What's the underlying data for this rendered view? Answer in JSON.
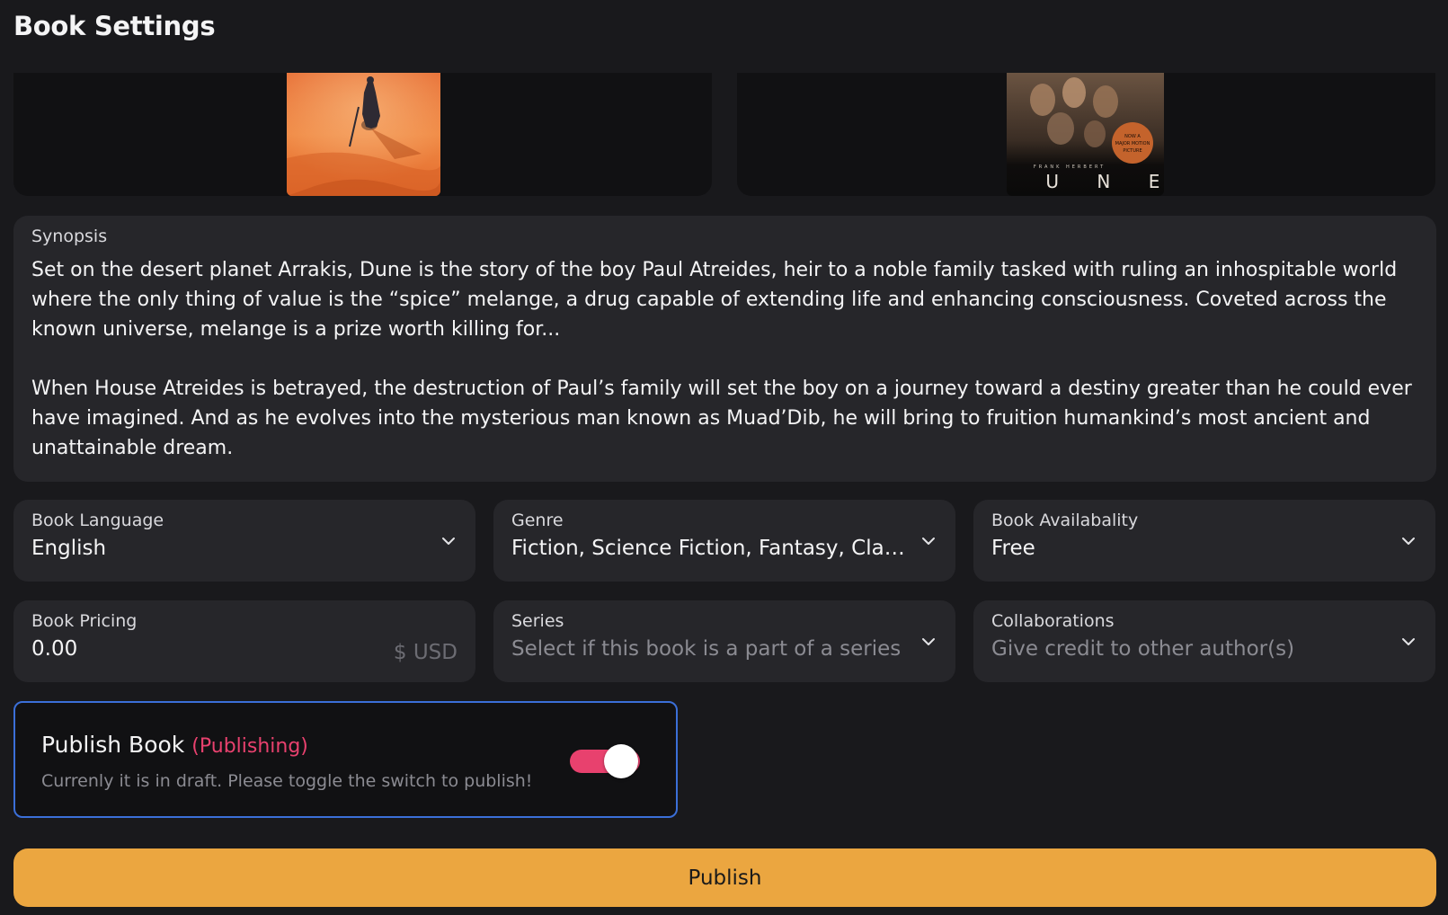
{
  "header": {
    "title": "Book Settings"
  },
  "covers": {
    "left": {
      "icon": "desert-figure-cover-image"
    },
    "right": {
      "icon": "dune-movie-cover-image",
      "author_text": "FRANK HERBERT",
      "title_text": "D U N E",
      "badge_text": "NOW A MAJOR MOTION PICTURE"
    }
  },
  "synopsis": {
    "label": "Synopsis",
    "paragraph1": "Set on the desert planet Arrakis, Dune is the story of the boy Paul Atreides, heir to a noble family tasked with ruling an inhospitable world where the only thing of value is the “spice” melange, a drug capable of extending life and enhancing consciousness. Coveted across the known universe, melange is a prize worth killing for...",
    "paragraph2": "When House Atreides is betrayed, the destruction of Paul’s family will set the boy on a journey toward a destiny greater than he could ever have imagined. And as he evolves into the mysterious man known as Muad’Dib, he will bring to fruition humankind’s most ancient and unattainable dream."
  },
  "fields": {
    "language": {
      "label": "Book Language",
      "value": "English"
    },
    "genre": {
      "label": "Genre",
      "value": "Fiction, Science Fiction, Fantasy, Clas..."
    },
    "availability": {
      "label": "Book Availabality",
      "value": "Free"
    },
    "pricing": {
      "label": "Book Pricing",
      "value": "0.00",
      "unit": "$ USD"
    },
    "series": {
      "label": "Series",
      "placeholder": "Select if this book is a part of a series"
    },
    "collaborations": {
      "label": "Collaborations",
      "placeholder": "Give credit to other author(s)"
    }
  },
  "publish_toggle": {
    "title": "Publish Book",
    "state": "(Publishing)",
    "description": "Currenly it is in draft. Please toggle the switch to publish!",
    "on": true
  },
  "publish_button": {
    "label": "Publish"
  },
  "colors": {
    "background": "#19191c",
    "card": "#26262a",
    "accent_pink": "#e8416e",
    "accent_orange": "#eba640",
    "focus_blue": "#3b6fd8"
  }
}
